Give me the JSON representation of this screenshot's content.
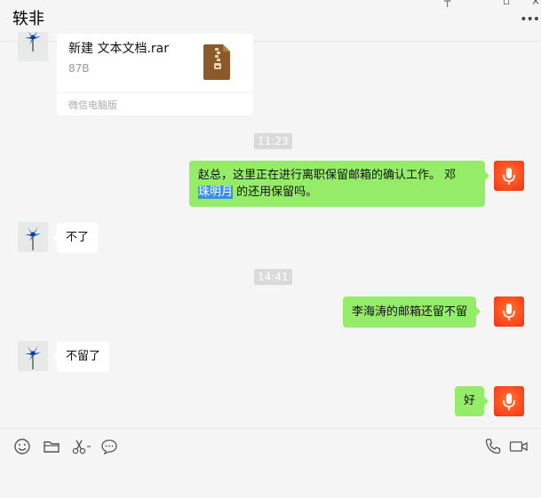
{
  "header": {
    "title": "轶非"
  },
  "messages": {
    "file": {
      "name": "新建 文本文档.rar",
      "size": "87B",
      "source": "微信电脑版"
    },
    "time1": "11:23",
    "out1_line1": "赵总，这里正在进行离职保留邮箱的确认工作。 邓",
    "out1_highlight": "珠明月",
    "out1_line2": " 的还用保留吗。",
    "in1": "不了",
    "time2": "14:41",
    "out2": "李海涛的邮箱还留不留",
    "in2": "不留了",
    "out3": "好"
  },
  "icons": {
    "toolbar": [
      "smiley-icon",
      "folder-icon",
      "scissors-icon",
      "chat-history-icon",
      "phone-icon",
      "video-icon"
    ]
  },
  "colors": {
    "outgoing_bubble": "#95ec69",
    "incoming_bubble": "#ffffff",
    "selection": "#3a8ee6",
    "mic_avatar": "#ff4f1f",
    "zip_icon": "#8b5a2b"
  }
}
